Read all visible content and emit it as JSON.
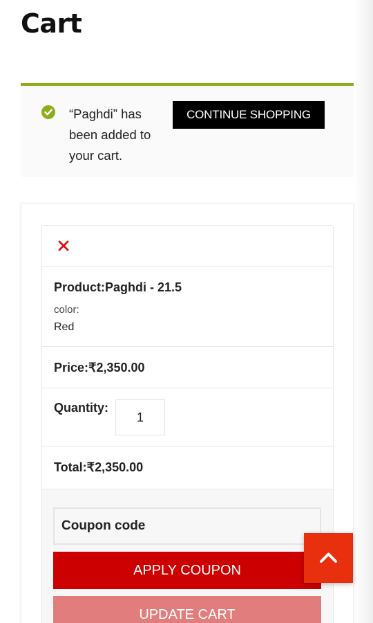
{
  "page": {
    "title": "Cart"
  },
  "notice": {
    "icon": "check-circle-icon",
    "text": "“Paghdi” has been added to your cart.",
    "button_label": "CONTINUE SHOPPING",
    "accent_color": "#8fae1b"
  },
  "cart": {
    "remove_icon": "close-icon",
    "product_line": "Product:Paghdi - 21.5",
    "variation_key": "color:",
    "variation_value": "Red",
    "price_line": "Price:₹2,350.00",
    "quantity_label": "Quantity:",
    "quantity_value": "1",
    "total_line": "Total:₹2,350.00"
  },
  "coupon": {
    "placeholder": "Coupon code",
    "apply_label": "APPLY COUPON",
    "update_label": "UPDATE CART",
    "apply_color": "#cc0000",
    "update_color": "#e27d7d"
  },
  "scroll_top": {
    "icon": "chevron-up-icon",
    "color": "#e8300f"
  }
}
